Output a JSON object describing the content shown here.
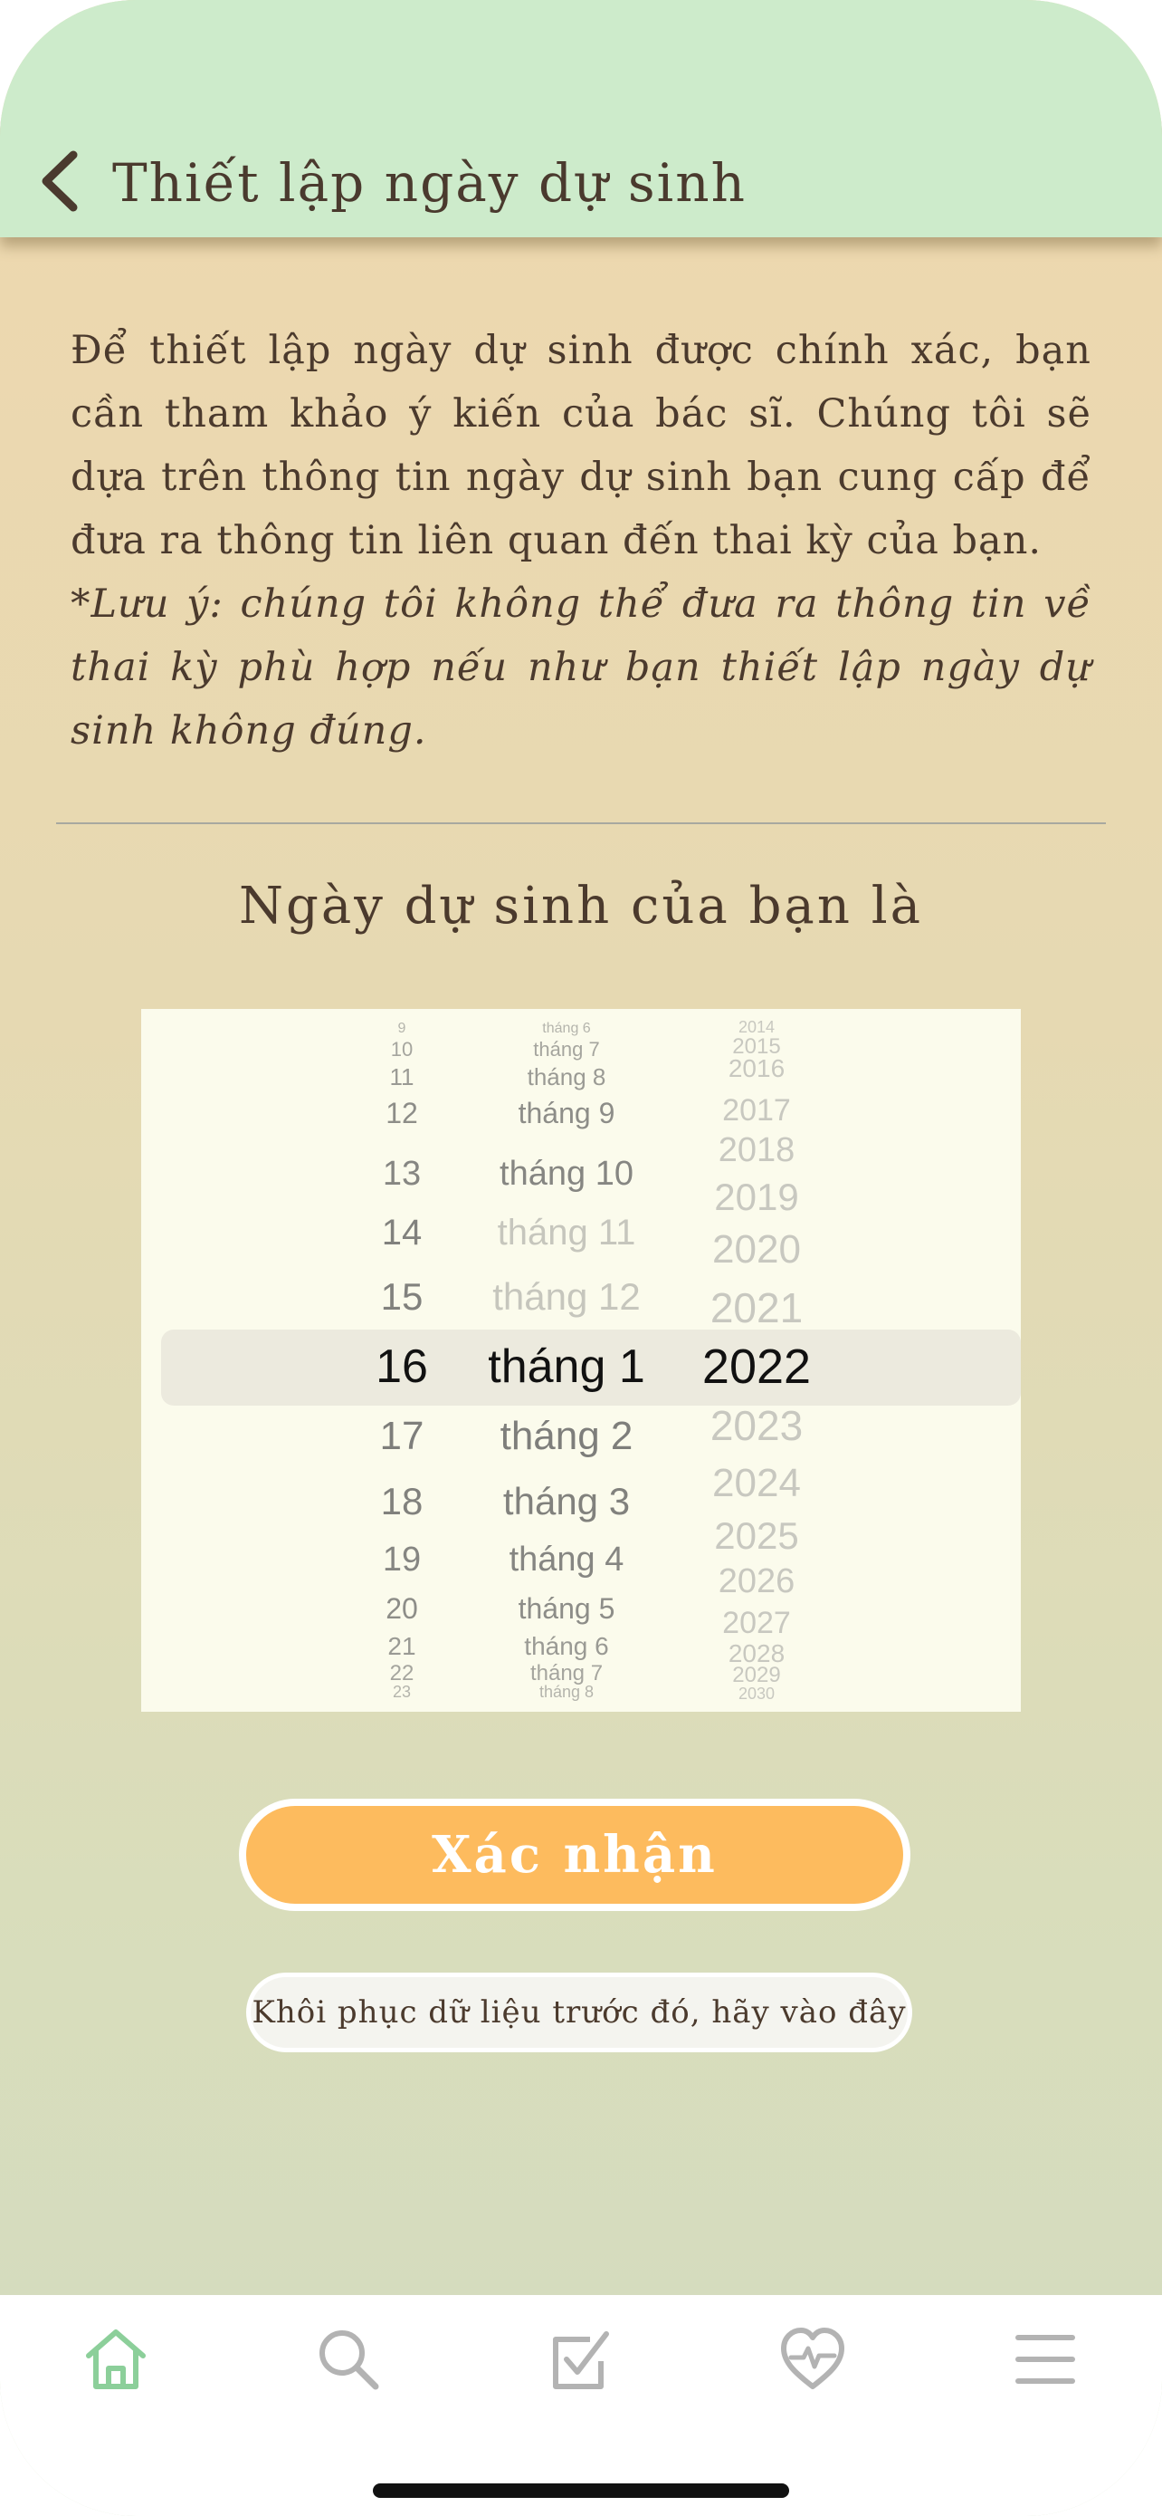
{
  "header": {
    "title": "Thiết lập ngày dự sinh",
    "back_icon": "chevron-left-icon"
  },
  "intro": {
    "text": "Để thiết lập ngày dự sinh được chính xác, bạn cần tham khảo ý kiến của bác sĩ. Chúng tôi sẽ dựa trên thông tin ngày dự sinh bạn cung cấp để đưa ra thông tin liên quan đến thai kỳ của bạn.",
    "note": "*Lưu ý: chúng tôi không thể đưa ra thông tin về thai kỳ phù hợp nếu như bạn thiết lập ngày dự sinh không đúng."
  },
  "question": "Ngày dự sinh của bạn là",
  "picker": {
    "selected": {
      "day": "16",
      "month": "tháng 1",
      "year": "2022"
    },
    "days": [
      "9",
      "10",
      "11",
      "12",
      "13",
      "14",
      "15",
      "16",
      "17",
      "18",
      "19",
      "20",
      "21",
      "22",
      "23"
    ],
    "months": [
      "tháng 6",
      "tháng 7",
      "tháng 8",
      "tháng 9",
      "tháng 10",
      "tháng 11",
      "tháng 12",
      "tháng 1",
      "tháng 2",
      "tháng 3",
      "tháng 4",
      "tháng 5",
      "tháng 6",
      "tháng 7",
      "tháng 8"
    ],
    "years": [
      "2014",
      "2015",
      "2016",
      "2017",
      "2018",
      "2019",
      "2020",
      "2021",
      "2022",
      "2023",
      "2024",
      "2025",
      "2026",
      "2027",
      "2028",
      "2029",
      "2030"
    ],
    "disabled_months": [
      "tháng 11",
      "tháng 12"
    ]
  },
  "buttons": {
    "confirm": "Xác nhận",
    "restore": "Khôi phục dữ liệu trước đó, hãy vào đây"
  },
  "tabbar": [
    {
      "icon": "home-icon",
      "active": true
    },
    {
      "icon": "search-icon",
      "active": false
    },
    {
      "icon": "checkbox-icon",
      "active": false
    },
    {
      "icon": "heart-pulse-icon",
      "active": false
    },
    {
      "icon": "menu-icon",
      "active": false
    }
  ],
  "colors": {
    "header_bg": "#cdebcb",
    "accent_button": "#fdbb5e",
    "active_tab": "#8ccf9a",
    "inactive_tab": "#b3b3b3",
    "text": "#4b3a2d"
  }
}
